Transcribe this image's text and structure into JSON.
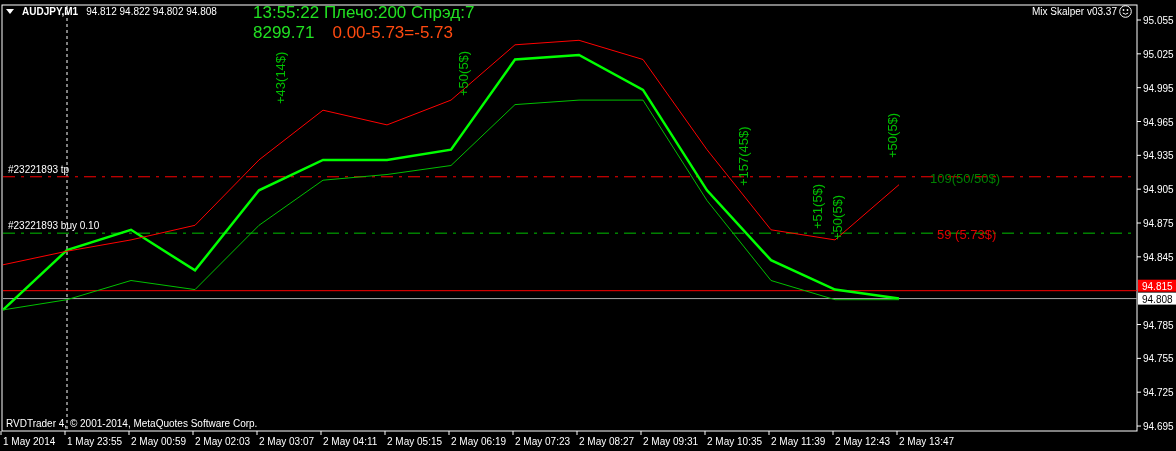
{
  "title_bar": {
    "symbol": "AUDJPY,M1",
    "quotes": "94.812 94.822 94.802 94.808"
  },
  "info": {
    "status": "13:55:22 Плечо:200 Спрэд:7",
    "balance": "8299.71",
    "result": "0.00-5.73=-5.73"
  },
  "indicator": {
    "name": "Mix Skalper v03.37"
  },
  "chart": {
    "chart_data": {
      "type": "line",
      "categories": [
        "1 May 2014",
        "1 May 23:55",
        "2 May 00:59",
        "2 May 02:03",
        "2 May 03:07",
        "2 May 04:11",
        "2 May 05:15",
        "2 May 06:19",
        "2 May 07:23",
        "2 May 08:27",
        "2 May 09:31",
        "2 May 10:35",
        "2 May 11:39",
        "2 May 12:43",
        "2 May 13:47"
      ],
      "series": [
        {
          "color": "#00ff00",
          "values": [
            94.798,
            94.851,
            94.869,
            94.833,
            94.904,
            94.931,
            94.931,
            94.94,
            95.02,
            95.024,
            94.993,
            94.904,
            94.842,
            94.816,
            94.808
          ]
        },
        {
          "color": "#ff0000",
          "values": [
            94.838,
            94.85,
            94.86,
            94.873,
            94.931,
            94.975,
            94.962,
            94.984,
            95.033,
            95.037,
            95.02,
            94.94,
            94.869,
            94.86,
            94.909
          ]
        },
        {
          "color": "#00c000",
          "values": [
            94.798,
            94.807,
            94.824,
            94.816,
            94.873,
            94.913,
            94.918,
            94.926,
            94.98,
            94.984,
            94.984,
            94.895,
            94.824,
            94.807,
            94.807
          ]
        }
      ],
      "ylim": [
        94.6906,
        95.0683
      ],
      "yticks": [
        {
          "value": 95.055,
          "label": "95.055"
        },
        {
          "value": 95.025,
          "label": "95.025"
        },
        {
          "value": 94.995,
          "label": "94.995"
        },
        {
          "value": 94.965,
          "label": "94.965"
        },
        {
          "value": 94.935,
          "label": "94.935"
        },
        {
          "value": 94.905,
          "label": "94.905"
        },
        {
          "value": 94.875,
          "label": "94.875"
        },
        {
          "value": 94.845,
          "label": "94.845"
        },
        {
          "value": 94.785,
          "label": "94.785"
        },
        {
          "value": 94.755,
          "label": "94.755"
        },
        {
          "value": 94.725,
          "label": "94.725"
        },
        {
          "value": 94.695,
          "label": "94.695"
        }
      ],
      "ref_lines": [
        {
          "axis": "y",
          "value": 94.916,
          "label": "#23221893 tp",
          "color": "#ff0000"
        },
        {
          "axis": "y",
          "value": 94.866,
          "label": "#23221893 buy 0.10",
          "color": "#00c000"
        },
        {
          "axis": "y",
          "value": 94.815,
          "label": "94.815",
          "color": "#ff0000"
        },
        {
          "axis": "y",
          "value": 94.808,
          "label": "94.808",
          "color": "#aaaaaa"
        },
        {
          "axis": "x",
          "value": "1 May 23:55",
          "color": "#ffffff"
        }
      ]
    },
    "level_notes": [
      {
        "text": "109(50/50$)",
        "color": "#008000"
      },
      {
        "text": "59 (5.73$)",
        "color": "#e00000"
      }
    ],
    "trade_labels": [
      "+43(14$)",
      "+50(5$)",
      "+157(45$)",
      "+51(5$)",
      "+50(5$)",
      "+50(5$)"
    ]
  },
  "copyright": "RVDTrader 4, © 2001-2014, MetaQuotes Software Corp."
}
